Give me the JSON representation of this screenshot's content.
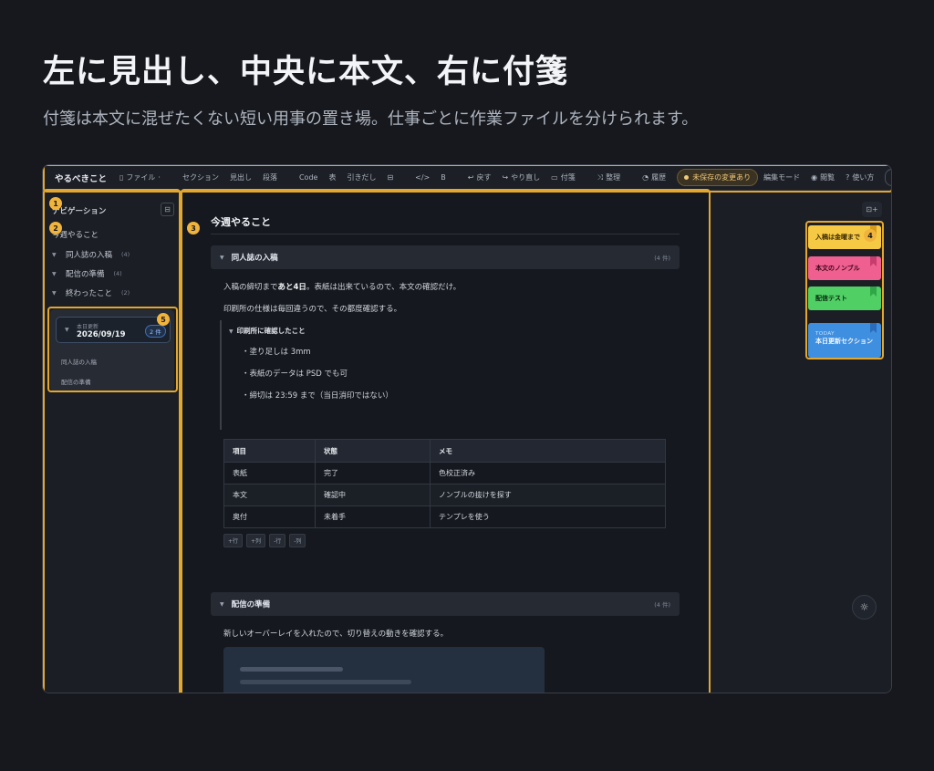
{
  "hero": {
    "title": "左に見出し、中央に本文、右に付箋",
    "subtitle": "付箋は本文に混ぜたくない短い用事の置き場。仕事ごとに作業ファイルを分けられます。"
  },
  "toolbar": {
    "brand": "やるべきこと",
    "file": "ファイル",
    "section": "セクション",
    "heading": "見出し",
    "paragraph": "段落",
    "code": "Code",
    "table": "表",
    "quote": "引きだし",
    "layout_icon": "⊟",
    "code_icon": "</>",
    "bold": "B",
    "undo": "戻す",
    "redo": "やり直し",
    "sticky": "付箋",
    "organize": "整理",
    "history": "履歴",
    "unsaved": "未保存の変更あり",
    "edit_mode": "編集モード",
    "view": "閲覧",
    "help": "使い方",
    "settings": "設"
  },
  "sidebar": {
    "header": "ナビゲーション",
    "root": "今週やること",
    "items": [
      {
        "label": "同人誌の入稿",
        "count": "(4)"
      },
      {
        "label": "配信の準備",
        "count": "(4)"
      },
      {
        "label": "終わったこと",
        "count": "(2)"
      }
    ],
    "card": {
      "label": "本日更新",
      "date": "2026/09/19",
      "badge": "2 件",
      "links": [
        "同人誌の入稿",
        "配信の準備"
      ]
    }
  },
  "editor": {
    "title": "今週やること",
    "sections": [
      {
        "title": "同人誌の入稿",
        "count": "(4 件)"
      },
      {
        "title": "配信の準備",
        "count": "(4 件)"
      }
    ],
    "p1_pre": "入稿の締切まで",
    "p1_bold": "あと4日",
    "p1_post": "。表紙は出来ているので、本文の確認だけ。",
    "p2": "印刷所の仕様は毎回違うので、その都度確認する。",
    "quote_head": "印刷所に確認したこと",
    "quote_items": [
      "・塗り足しは 3mm",
      "・表紙のデータは PSD でも可",
      "・締切は 23:59 まで（当日消印ではない）"
    ],
    "table": {
      "headers": [
        "項目",
        "状態",
        "メモ"
      ],
      "rows": [
        [
          "表紙",
          "完了",
          "色校正済み"
        ],
        [
          "本文",
          "確認中",
          "ノンブルの抜けを探す"
        ],
        [
          "奥付",
          "未着手",
          "テンプレを使う"
        ]
      ]
    },
    "table_buttons": [
      "+行",
      "+列",
      "-行",
      "-列"
    ],
    "p3": "新しいオーバーレイを入れたので、切り替えの動きを確認する。"
  },
  "stickies": [
    {
      "text": "入稿は金曜まで",
      "color": "#f6c945",
      "tab": "#d79a1d"
    },
    {
      "text": "本文のノンブル",
      "color": "#ef5f8f",
      "tab": "#c73c6e"
    },
    {
      "text": "配信テスト",
      "color": "#4fcf64",
      "tab": "#2fa746"
    },
    {
      "label": "TODAY",
      "text": "本日更新セクション",
      "color": "#3f8fe0",
      "tab": "#2a6cb9"
    }
  ],
  "right_pane": {
    "add_icon": "⊡+",
    "gear_icon": "☼"
  },
  "badges": [
    "1",
    "2",
    "3",
    "4",
    "5"
  ],
  "colors": {
    "highlight": "#e3a72f",
    "background": "#16181d",
    "accent_unsaved": "#f1c97a"
  }
}
